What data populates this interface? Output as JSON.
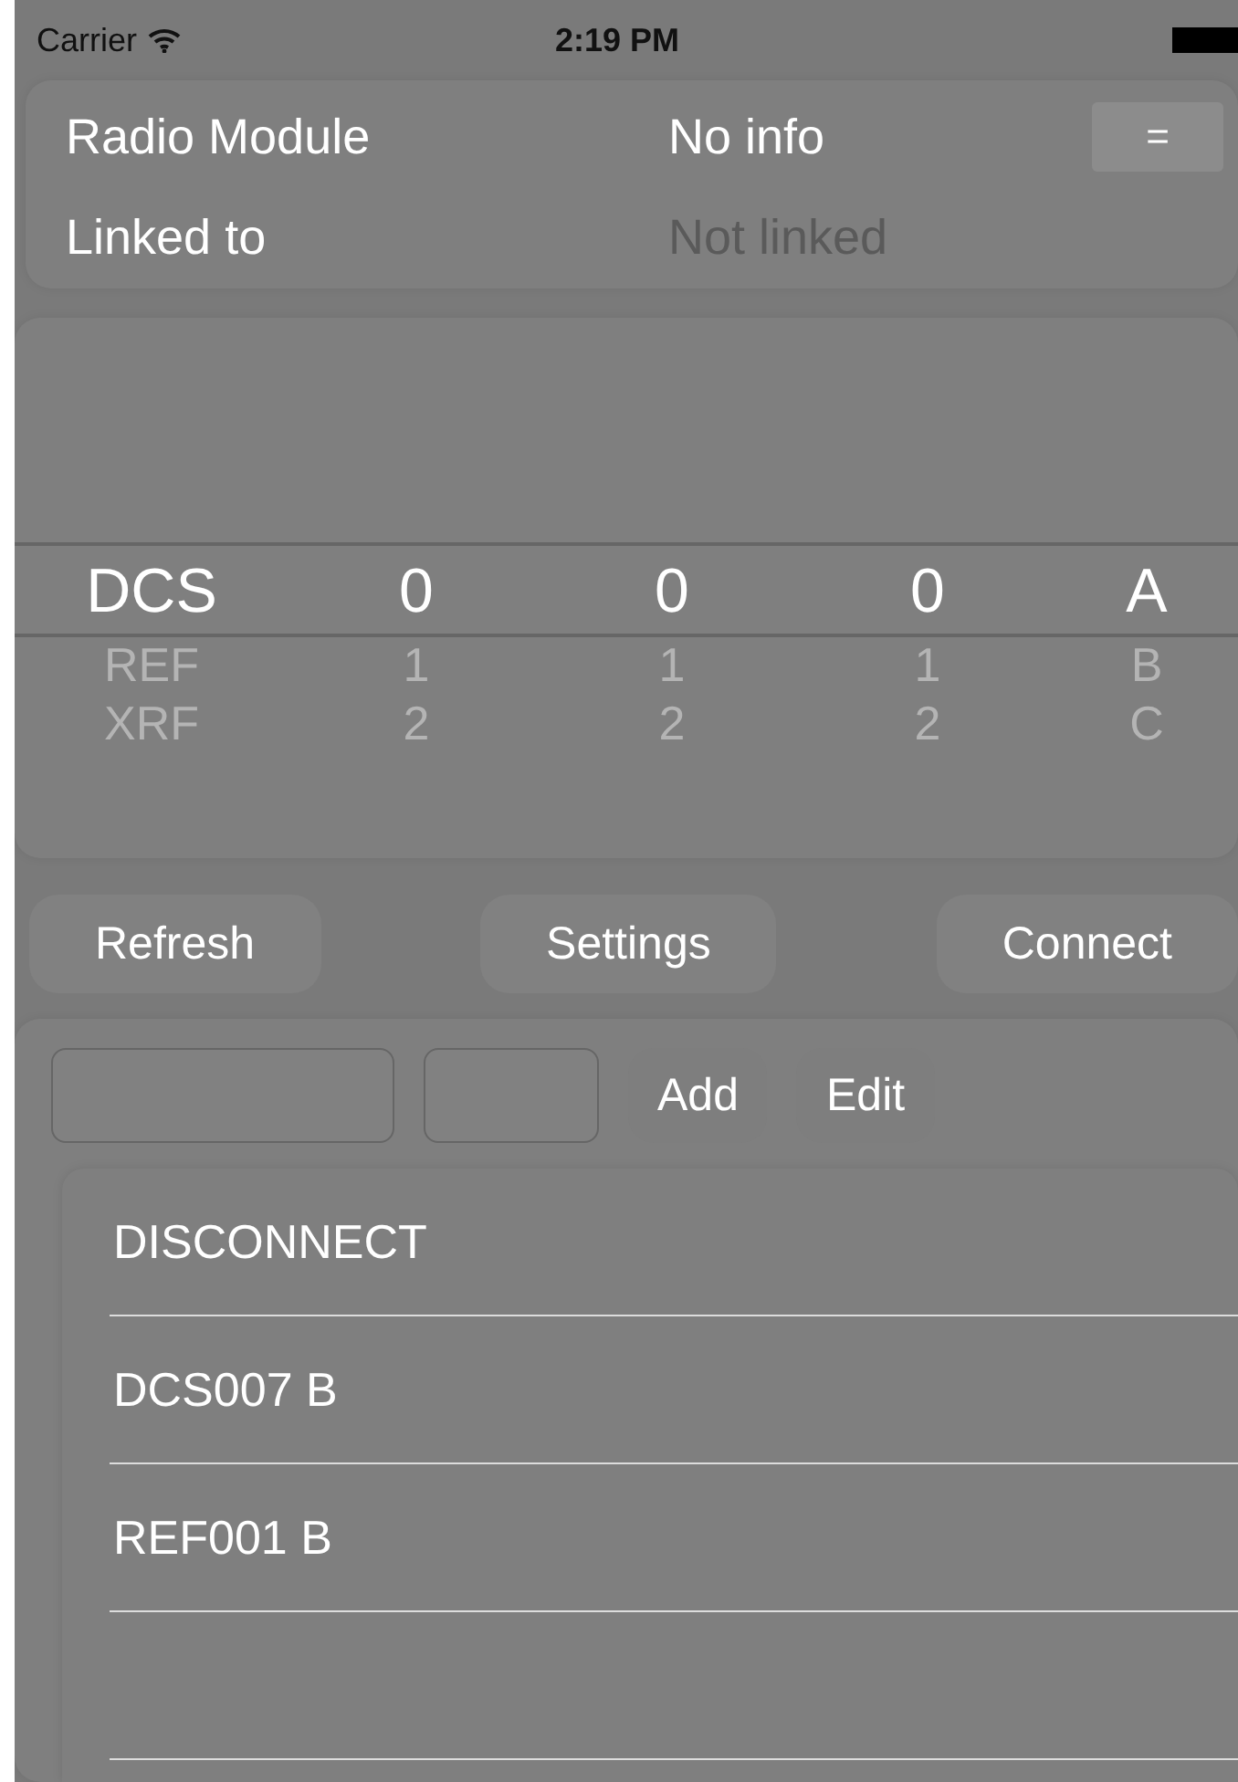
{
  "status_bar": {
    "carrier": "Carrier",
    "time": "2:19 PM"
  },
  "info": {
    "rows": [
      {
        "label": "Radio Module",
        "value": "No info",
        "dimmed": false
      },
      {
        "label": "Linked to",
        "value": "Not linked",
        "dimmed": true
      }
    ],
    "menu_button": "="
  },
  "picker": {
    "columns": [
      {
        "items": [
          {
            "label": "DCS",
            "selected": true
          },
          {
            "label": "REF",
            "selected": false
          },
          {
            "label": "XRF",
            "selected": false
          }
        ]
      },
      {
        "items": [
          {
            "label": "0",
            "selected": true
          },
          {
            "label": "1",
            "selected": false
          },
          {
            "label": "2",
            "selected": false
          }
        ]
      },
      {
        "items": [
          {
            "label": "0",
            "selected": true
          },
          {
            "label": "1",
            "selected": false
          },
          {
            "label": "2",
            "selected": false
          }
        ]
      },
      {
        "items": [
          {
            "label": "0",
            "selected": true
          },
          {
            "label": "1",
            "selected": false
          },
          {
            "label": "2",
            "selected": false
          }
        ]
      },
      {
        "items": [
          {
            "label": "A",
            "selected": true
          },
          {
            "label": "B",
            "selected": false
          },
          {
            "label": "C",
            "selected": false
          }
        ]
      }
    ]
  },
  "actions": [
    "Refresh",
    "Settings",
    "Connect"
  ],
  "editor": {
    "buttons": [
      "Add",
      "Edit"
    ]
  },
  "list": {
    "items": [
      "DISCONNECT",
      "DCS007 B",
      "REF001 B"
    ]
  }
}
